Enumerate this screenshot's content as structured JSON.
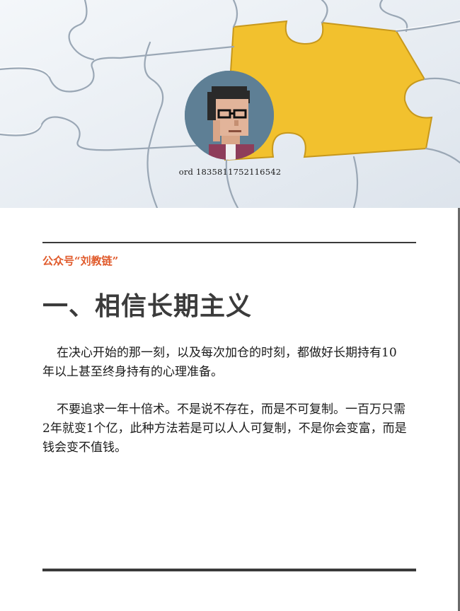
{
  "hero": {
    "image_subject": "jigsaw puzzle with one yellow missing piece",
    "ord_caption": "ord 1835811752116542"
  },
  "avatar": {
    "subject": "pixel-art portrait of man with glasses"
  },
  "article": {
    "source_label": "公众号“刘教链”",
    "heading": "一、相信长期主义",
    "paragraphs": [
      "在决心开始的那一刻，以及每次加仓的时刻，都做好长期持有10年以上甚至终身持有的心理准备。",
      "不要追求一年十倍术。不是说不存在，而是不可复制。一百万只需2年就变1个亿，此种方法若是可以人人可复制，不是你会变富，而是钱会变不值钱。"
    ]
  },
  "colors": {
    "accent": "#e05a2b",
    "heading": "#3b3b3b",
    "puzzle_yellow": "#f2c12e",
    "avatar_bg": "#5e7f95"
  }
}
